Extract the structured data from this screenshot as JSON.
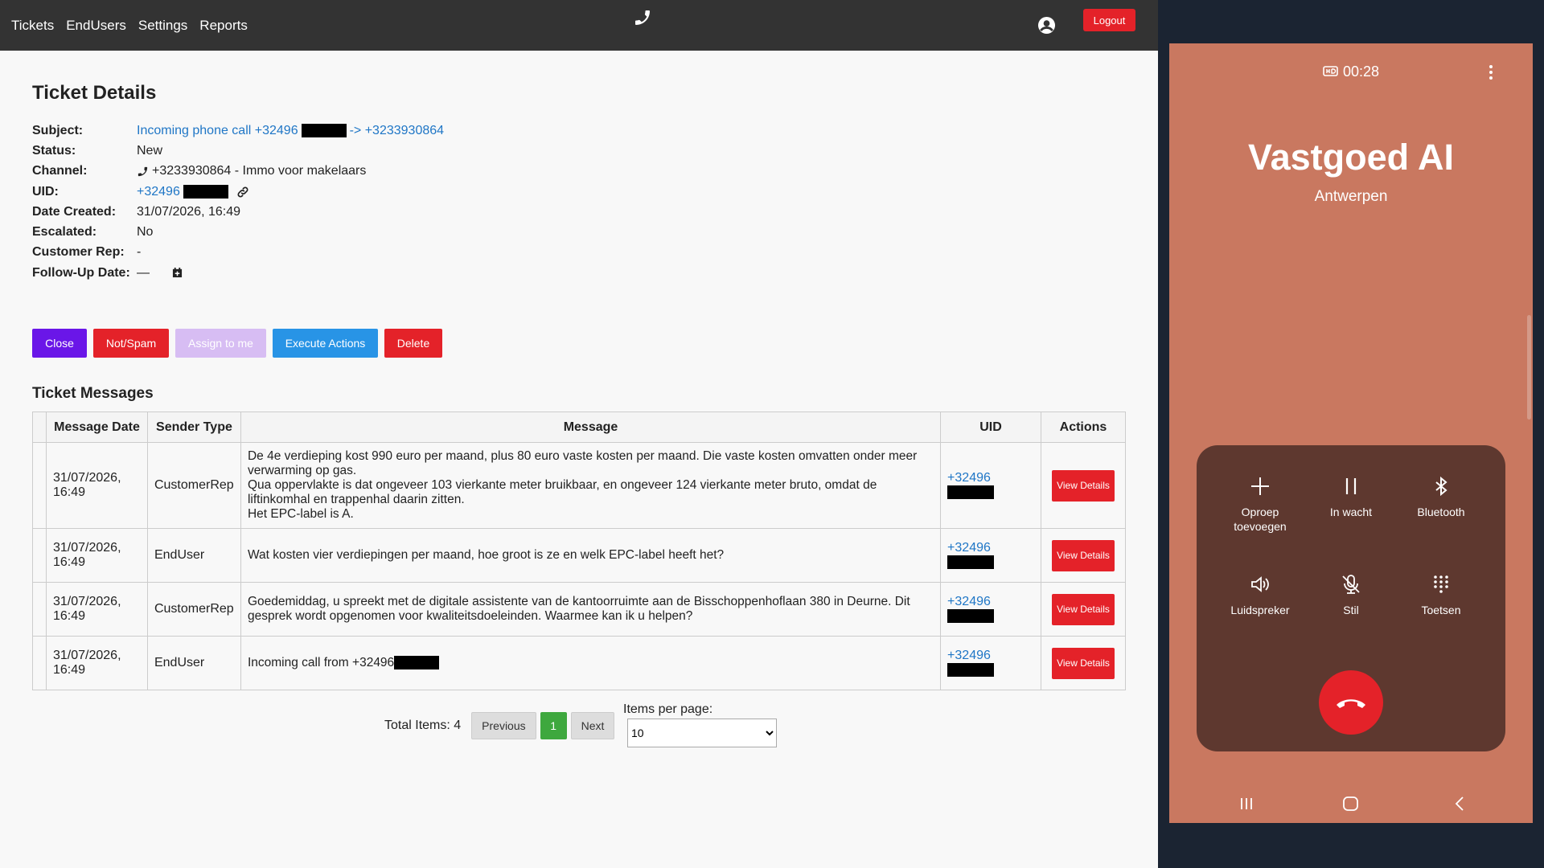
{
  "nav": {
    "items": [
      "Tickets",
      "EndUsers",
      "Settings",
      "Reports"
    ],
    "logout": "Logout"
  },
  "ticket": {
    "title": "Ticket Details",
    "labels": {
      "subject": "Subject:",
      "status": "Status:",
      "channel": "Channel:",
      "uid": "UID:",
      "date_created": "Date Created:",
      "escalated": "Escalated:",
      "customer_rep": "Customer Rep:",
      "follow_up": "Follow-Up Date:"
    },
    "subject_prefix": "Incoming phone call +32496",
    "subject_suffix": "-> +3233930864",
    "status": "New",
    "channel": "+3233930864 - Immo voor makelaars",
    "uid": "+32496",
    "date_created": "31/07/2026, 16:49",
    "escalated": "No",
    "customer_rep": "-",
    "follow_up": "—"
  },
  "actions": {
    "close": "Close",
    "notspam": "Not/Spam",
    "assign": "Assign to me",
    "execute": "Execute Actions",
    "delete": "Delete"
  },
  "colors": {
    "close": "#6a16e8",
    "notspam": "#e42229",
    "assign": "#d7bdf3",
    "execute": "#2894e6",
    "delete": "#e42229",
    "pager_active": "#3ea83e"
  },
  "messages": {
    "title": "Ticket Messages",
    "headers": [
      "Message Date",
      "Sender Type",
      "Message",
      "UID",
      "Actions"
    ],
    "view_label": "View Details",
    "rows": [
      {
        "date": "31/07/2026, 16:49",
        "sender": "CustomerRep",
        "message": [
          "De 4e verdieping kost 990 euro per maand, plus 80 euro vaste kosten per maand. Die vaste kosten omvatten onder meer verwarming op gas.",
          "Qua oppervlakte is dat ongeveer 103 vierkante meter bruikbaar, en ongeveer 124 vierkante meter bruto, omdat de liftinkomhal en trappenhal daarin zitten.",
          "Het EPC-label is A."
        ],
        "uid": "+32496"
      },
      {
        "date": "31/07/2026, 16:49",
        "sender": "EndUser",
        "message": [
          "Wat kosten vier verdiepingen per maand, hoe groot is ze en welk EPC-label heeft het?"
        ],
        "uid": "+32496"
      },
      {
        "date": "31/07/2026, 16:49",
        "sender": "CustomerRep",
        "message": [
          "Goedemiddag, u spreekt met de digitale assistente van de kantoorruimte aan de Bisschoppenhoflaan 380 in Deurne. Dit gesprek wordt opgenomen voor kwaliteitsdoeleinden. Waarmee kan ik u helpen?"
        ],
        "uid": "+32496"
      },
      {
        "date": "31/07/2026, 16:49",
        "sender": "EndUser",
        "message": [
          "Incoming call from +32496"
        ],
        "uid": "+32496"
      }
    ]
  },
  "pagination": {
    "total": "Total Items: 4",
    "previous": "Previous",
    "current": "1",
    "next": "Next",
    "per_page_label": "Items per page:",
    "per_page": "10"
  },
  "phone": {
    "timer": "00:28",
    "caller": "Vastgoed AI",
    "location": "Antwerpen",
    "controls": {
      "add": "Oproep toevoegen",
      "hold": "In wacht",
      "bluetooth": "Bluetooth",
      "speaker": "Luidspreker",
      "mute": "Stil",
      "keypad": "Toetsen"
    },
    "bg_color": "#c97860",
    "panel_color": "#5e382f"
  }
}
